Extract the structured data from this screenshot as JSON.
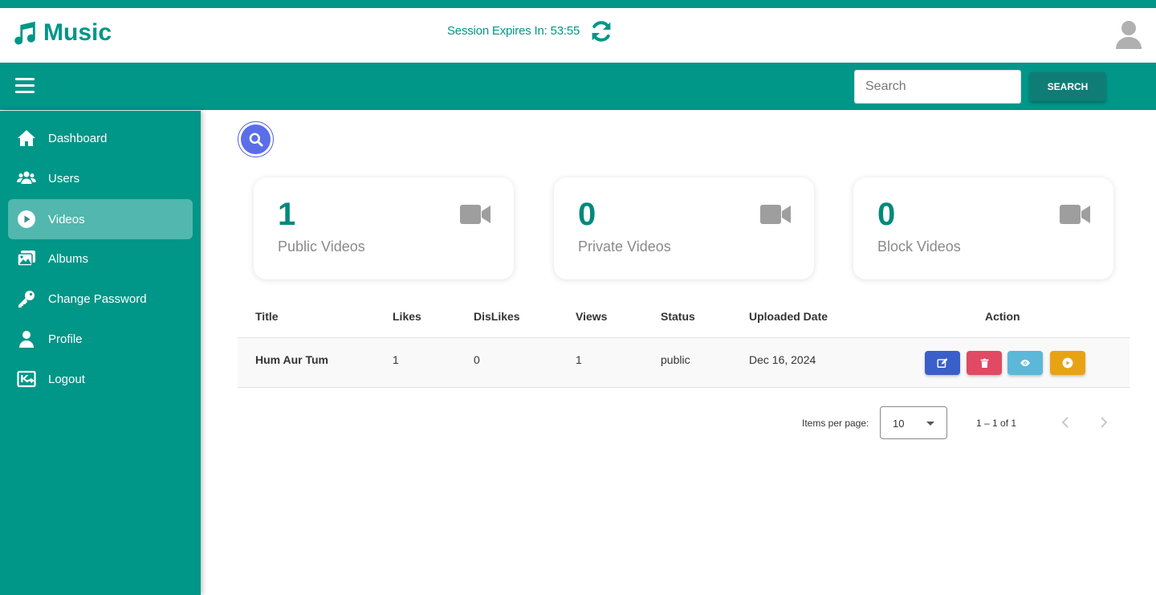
{
  "colors": {
    "primary": "#009688",
    "edit": "#3b5fc9",
    "delete": "#e04a62",
    "view": "#5bb8d8",
    "play": "#e8a315"
  },
  "header": {
    "brand": "Music",
    "session_label": "Session Expires In:",
    "session_time": "53:55"
  },
  "navbar": {
    "search_placeholder": "Search",
    "search_button": "SEARCH"
  },
  "sidebar": {
    "items": [
      {
        "label": "Dashboard",
        "icon": "home-icon"
      },
      {
        "label": "Users",
        "icon": "users-icon"
      },
      {
        "label": "Videos",
        "icon": "play-circle-icon",
        "active": true
      },
      {
        "label": "Albums",
        "icon": "images-icon"
      },
      {
        "label": "Change Password",
        "icon": "key-icon"
      },
      {
        "label": "Profile",
        "icon": "user-icon"
      },
      {
        "label": "Logout",
        "icon": "logout-icon"
      }
    ]
  },
  "cards": [
    {
      "value": "1",
      "label": "Public Videos",
      "icon": "video-camera-icon"
    },
    {
      "value": "0",
      "label": "Private Videos",
      "icon": "video-camera-icon"
    },
    {
      "value": "0",
      "label": "Block Videos",
      "icon": "video-camera-icon"
    }
  ],
  "table": {
    "headers": [
      "Title",
      "Likes",
      "DisLikes",
      "Views",
      "Status",
      "Uploaded Date",
      "Action"
    ],
    "rows": [
      {
        "title": "Hum Aur Tum",
        "likes": "1",
        "dislikes": "0",
        "views": "1",
        "status": "public",
        "date": "Dec 16, 2024"
      }
    ]
  },
  "pagination": {
    "items_label": "Items per page:",
    "page_size": "10",
    "range": "1 – 1 of 1"
  }
}
